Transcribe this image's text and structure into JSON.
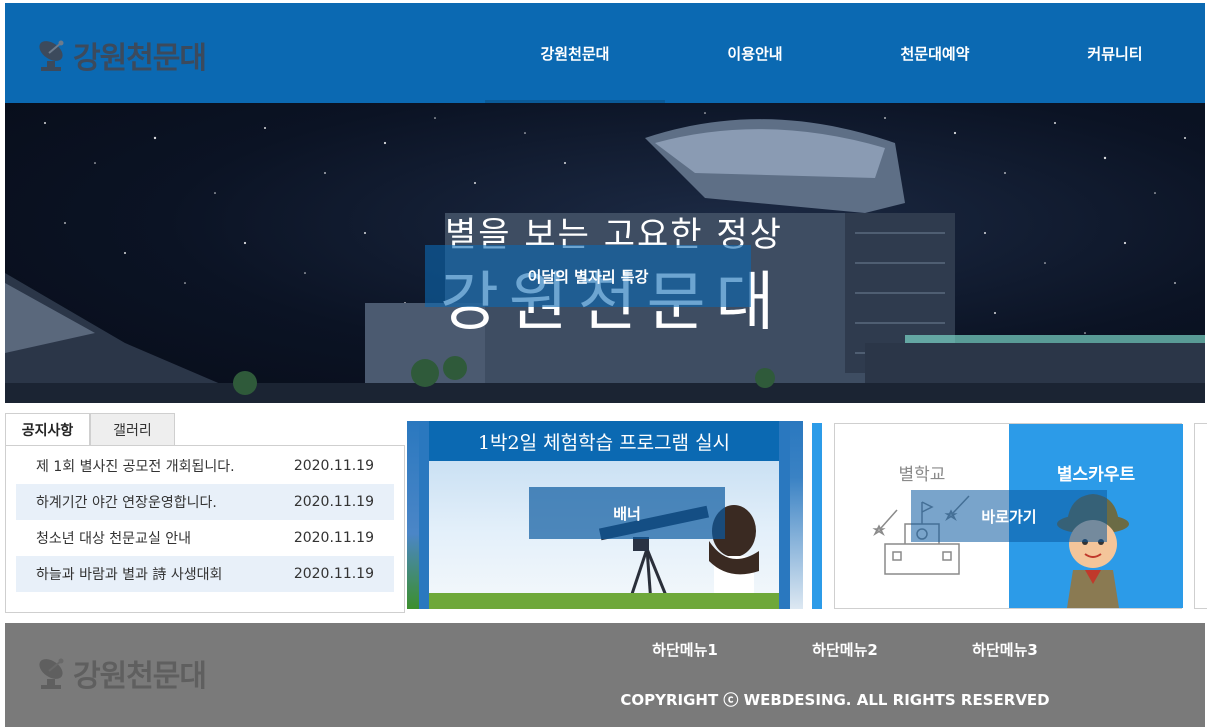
{
  "header": {
    "logo_text": "강원천문대",
    "nav": [
      "강원천문대",
      "이용안내",
      "천문대예약",
      "커뮤니티"
    ]
  },
  "hero": {
    "subtitle": "별을 보는 고요한 정상",
    "title": "강원천문대",
    "caption": "이달의 별자리 특강"
  },
  "notice": {
    "tabs": [
      "공지사항",
      "갤러리"
    ],
    "active_tab": 0,
    "items": [
      {
        "title": "제 1회 별사진 공모전 개회됩니다.",
        "date": "2020.11.19"
      },
      {
        "title": "하계기간 야간 연장운영합니다.",
        "date": "2020.11.19"
      },
      {
        "title": "청소년 대상 천문교실 안내",
        "date": "2020.11.19"
      },
      {
        "title": "하늘과 바람과 별과 詩 사생대회",
        "date": "2020.11.19"
      }
    ]
  },
  "banner": {
    "heading": "1박2일 체험학습 프로그램 실시",
    "label": "배너"
  },
  "quick": {
    "left_title": "별학교",
    "right_title": "별스카우트",
    "link_label": "바로가기",
    "accent": "#2c9be8"
  },
  "footer": {
    "logo_text": "강원천문대",
    "menu": [
      "하단메뉴1",
      "하단메뉴2",
      "하단메뉴3"
    ],
    "copyright": "COPYRIGHT ⓒ WEBDESING. ALL RIGHTS RESERVED"
  },
  "colors": {
    "primary": "#0b69b2",
    "footer_bg": "#7a7a7a",
    "notice_alt": "#e8f0f9"
  }
}
